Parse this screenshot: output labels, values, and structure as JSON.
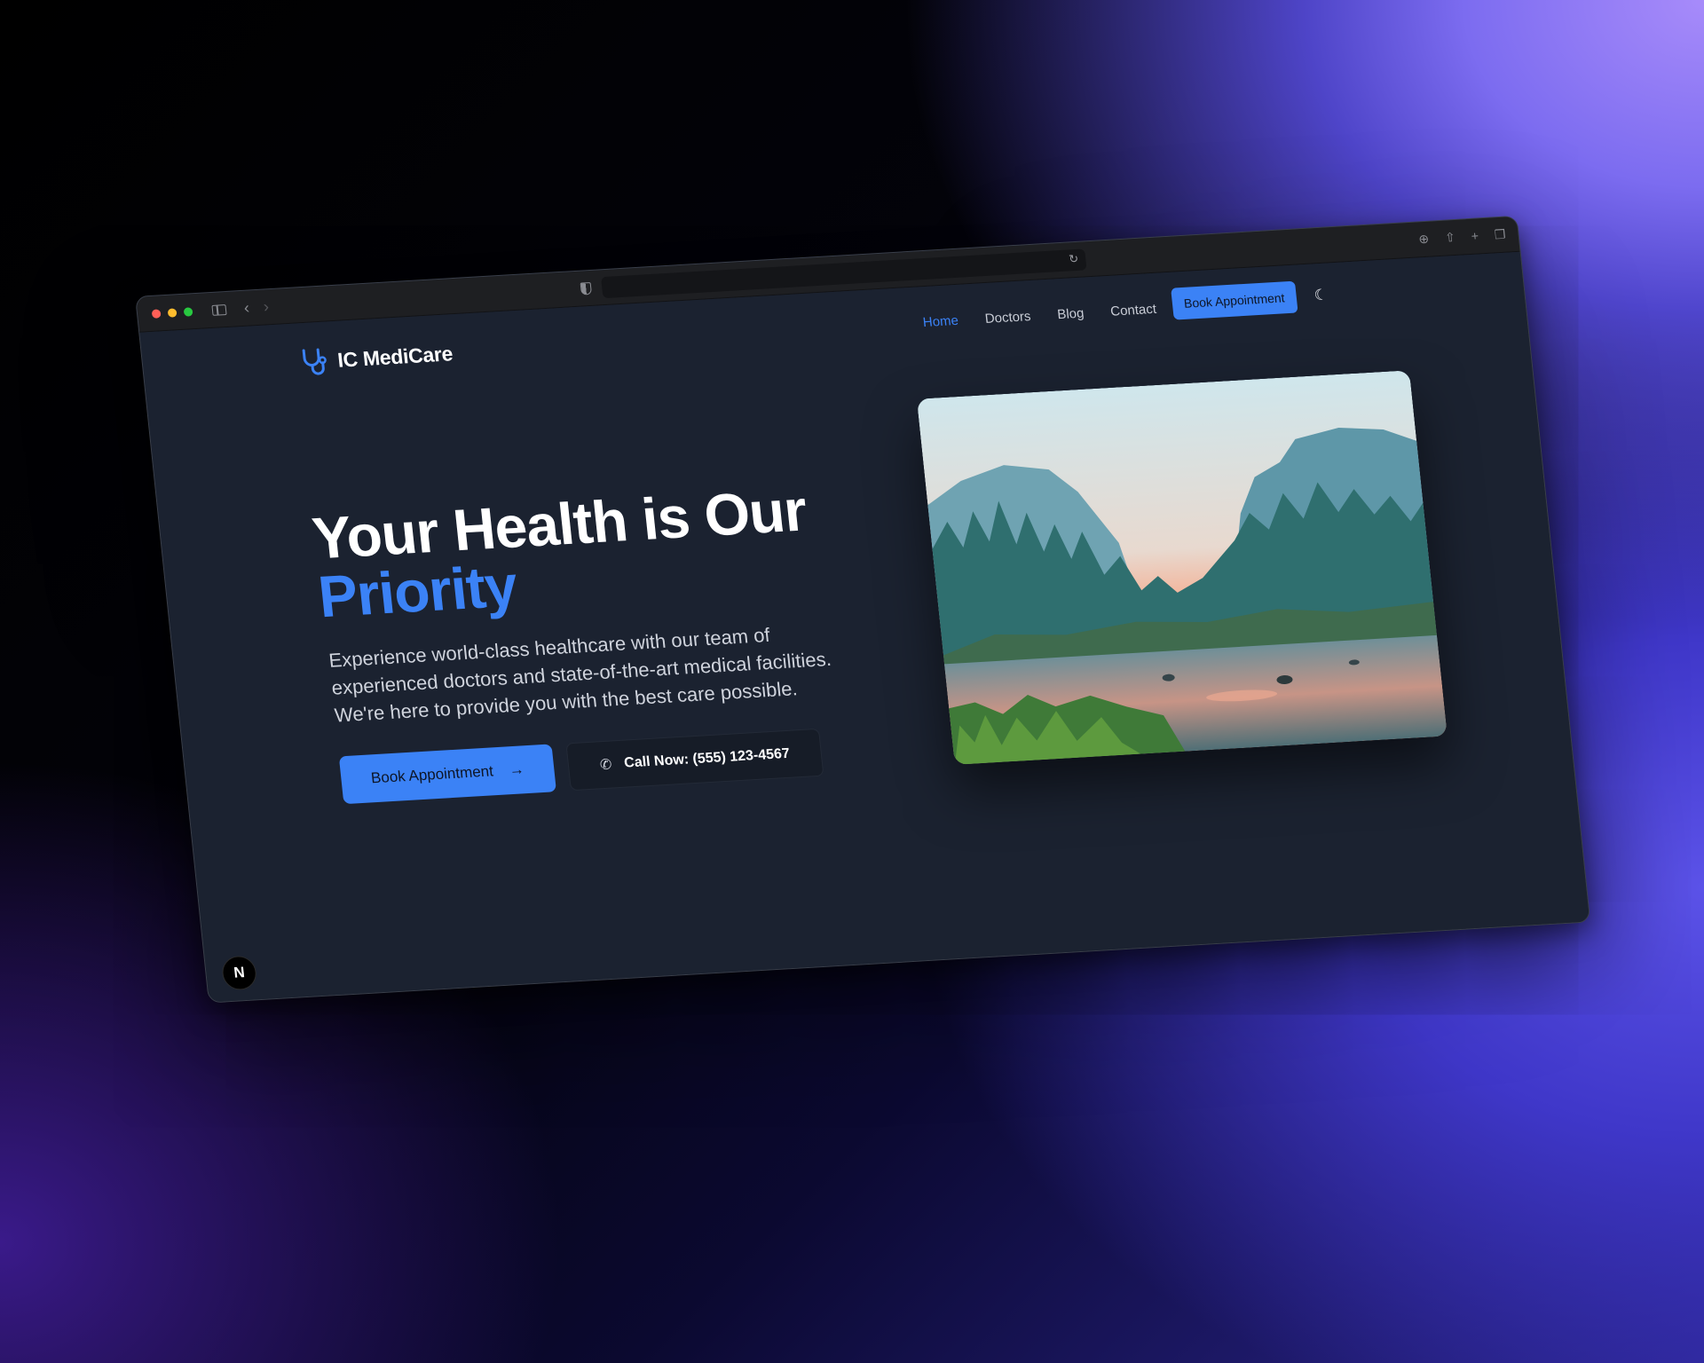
{
  "browser": {
    "controls": [
      "close",
      "minimize",
      "maximize"
    ],
    "icons": [
      "sidebar-icon",
      "back-icon",
      "forward-icon",
      "shield-icon",
      "reload-icon",
      "download-icon",
      "share-icon",
      "new-tab-icon",
      "tabs-icon"
    ]
  },
  "nav": {
    "brand": "IC MediCare",
    "links": [
      {
        "label": "Home",
        "active": true
      },
      {
        "label": "Doctors",
        "active": false
      },
      {
        "label": "Blog",
        "active": false
      },
      {
        "label": "Contact",
        "active": false
      }
    ],
    "cta": "Book Appointment",
    "theme_icon": "moon-icon"
  },
  "hero": {
    "title_line1": "Your Health is Our",
    "title_accent": "Priority",
    "description": "Experience world-class healthcare with our team of experienced doctors and state-of-the-art medical facilities. We're here to provide you with the best care possible.",
    "primary_button": "Book Appointment",
    "secondary_button": "Call Now: (555) 123-4567",
    "image_subject": "mountain valley river at sunset"
  },
  "badge": "N",
  "colors": {
    "accent": "#3b82f6",
    "page_bg": "#1b2230",
    "text": "#ffffff"
  }
}
